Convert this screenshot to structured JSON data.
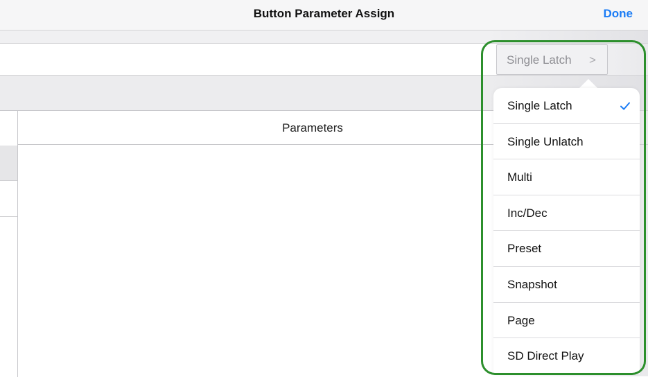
{
  "nav": {
    "title": "Button Parameter Assign",
    "done_label": "Done"
  },
  "table": {
    "header_label": "Parameters"
  },
  "mode_button": {
    "label": "Single Latch",
    "chevron": ">"
  },
  "popover": {
    "selected_index": 0,
    "options": [
      {
        "label": "Single Latch",
        "selected": true
      },
      {
        "label": "Single Unlatch",
        "selected": false
      },
      {
        "label": "Multi",
        "selected": false
      },
      {
        "label": "Inc/Dec",
        "selected": false
      },
      {
        "label": "Preset",
        "selected": false
      },
      {
        "label": "Snapshot",
        "selected": false
      },
      {
        "label": "Page",
        "selected": false
      },
      {
        "label": "SD Direct Play",
        "selected": false
      }
    ]
  },
  "colors": {
    "accent": "#1b7cf5",
    "highlight_ring": "#2c8f2c"
  },
  "icons": {
    "checkmark": "checkmark-icon",
    "chevron": "chevron-right-icon"
  }
}
